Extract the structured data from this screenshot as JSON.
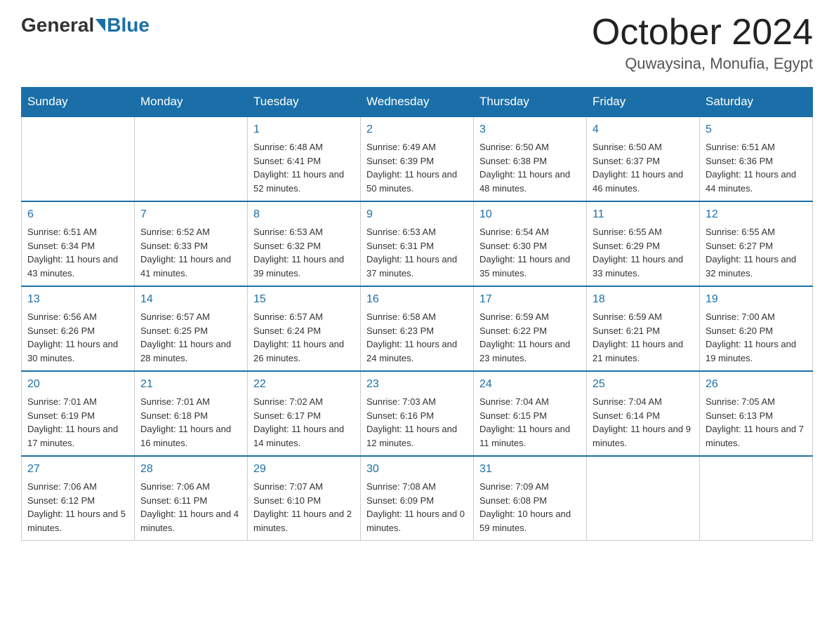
{
  "logo": {
    "general": "General",
    "blue": "Blue"
  },
  "title": "October 2024",
  "location": "Quwaysina, Monufia, Egypt",
  "days": [
    "Sunday",
    "Monday",
    "Tuesday",
    "Wednesday",
    "Thursday",
    "Friday",
    "Saturday"
  ],
  "weeks": [
    [
      {
        "num": "",
        "sunrise": "",
        "sunset": "",
        "daylight": ""
      },
      {
        "num": "",
        "sunrise": "",
        "sunset": "",
        "daylight": ""
      },
      {
        "num": "1",
        "sunrise": "Sunrise: 6:48 AM",
        "sunset": "Sunset: 6:41 PM",
        "daylight": "Daylight: 11 hours and 52 minutes."
      },
      {
        "num": "2",
        "sunrise": "Sunrise: 6:49 AM",
        "sunset": "Sunset: 6:39 PM",
        "daylight": "Daylight: 11 hours and 50 minutes."
      },
      {
        "num": "3",
        "sunrise": "Sunrise: 6:50 AM",
        "sunset": "Sunset: 6:38 PM",
        "daylight": "Daylight: 11 hours and 48 minutes."
      },
      {
        "num": "4",
        "sunrise": "Sunrise: 6:50 AM",
        "sunset": "Sunset: 6:37 PM",
        "daylight": "Daylight: 11 hours and 46 minutes."
      },
      {
        "num": "5",
        "sunrise": "Sunrise: 6:51 AM",
        "sunset": "Sunset: 6:36 PM",
        "daylight": "Daylight: 11 hours and 44 minutes."
      }
    ],
    [
      {
        "num": "6",
        "sunrise": "Sunrise: 6:51 AM",
        "sunset": "Sunset: 6:34 PM",
        "daylight": "Daylight: 11 hours and 43 minutes."
      },
      {
        "num": "7",
        "sunrise": "Sunrise: 6:52 AM",
        "sunset": "Sunset: 6:33 PM",
        "daylight": "Daylight: 11 hours and 41 minutes."
      },
      {
        "num": "8",
        "sunrise": "Sunrise: 6:53 AM",
        "sunset": "Sunset: 6:32 PM",
        "daylight": "Daylight: 11 hours and 39 minutes."
      },
      {
        "num": "9",
        "sunrise": "Sunrise: 6:53 AM",
        "sunset": "Sunset: 6:31 PM",
        "daylight": "Daylight: 11 hours and 37 minutes."
      },
      {
        "num": "10",
        "sunrise": "Sunrise: 6:54 AM",
        "sunset": "Sunset: 6:30 PM",
        "daylight": "Daylight: 11 hours and 35 minutes."
      },
      {
        "num": "11",
        "sunrise": "Sunrise: 6:55 AM",
        "sunset": "Sunset: 6:29 PM",
        "daylight": "Daylight: 11 hours and 33 minutes."
      },
      {
        "num": "12",
        "sunrise": "Sunrise: 6:55 AM",
        "sunset": "Sunset: 6:27 PM",
        "daylight": "Daylight: 11 hours and 32 minutes."
      }
    ],
    [
      {
        "num": "13",
        "sunrise": "Sunrise: 6:56 AM",
        "sunset": "Sunset: 6:26 PM",
        "daylight": "Daylight: 11 hours and 30 minutes."
      },
      {
        "num": "14",
        "sunrise": "Sunrise: 6:57 AM",
        "sunset": "Sunset: 6:25 PM",
        "daylight": "Daylight: 11 hours and 28 minutes."
      },
      {
        "num": "15",
        "sunrise": "Sunrise: 6:57 AM",
        "sunset": "Sunset: 6:24 PM",
        "daylight": "Daylight: 11 hours and 26 minutes."
      },
      {
        "num": "16",
        "sunrise": "Sunrise: 6:58 AM",
        "sunset": "Sunset: 6:23 PM",
        "daylight": "Daylight: 11 hours and 24 minutes."
      },
      {
        "num": "17",
        "sunrise": "Sunrise: 6:59 AM",
        "sunset": "Sunset: 6:22 PM",
        "daylight": "Daylight: 11 hours and 23 minutes."
      },
      {
        "num": "18",
        "sunrise": "Sunrise: 6:59 AM",
        "sunset": "Sunset: 6:21 PM",
        "daylight": "Daylight: 11 hours and 21 minutes."
      },
      {
        "num": "19",
        "sunrise": "Sunrise: 7:00 AM",
        "sunset": "Sunset: 6:20 PM",
        "daylight": "Daylight: 11 hours and 19 minutes."
      }
    ],
    [
      {
        "num": "20",
        "sunrise": "Sunrise: 7:01 AM",
        "sunset": "Sunset: 6:19 PM",
        "daylight": "Daylight: 11 hours and 17 minutes."
      },
      {
        "num": "21",
        "sunrise": "Sunrise: 7:01 AM",
        "sunset": "Sunset: 6:18 PM",
        "daylight": "Daylight: 11 hours and 16 minutes."
      },
      {
        "num": "22",
        "sunrise": "Sunrise: 7:02 AM",
        "sunset": "Sunset: 6:17 PM",
        "daylight": "Daylight: 11 hours and 14 minutes."
      },
      {
        "num": "23",
        "sunrise": "Sunrise: 7:03 AM",
        "sunset": "Sunset: 6:16 PM",
        "daylight": "Daylight: 11 hours and 12 minutes."
      },
      {
        "num": "24",
        "sunrise": "Sunrise: 7:04 AM",
        "sunset": "Sunset: 6:15 PM",
        "daylight": "Daylight: 11 hours and 11 minutes."
      },
      {
        "num": "25",
        "sunrise": "Sunrise: 7:04 AM",
        "sunset": "Sunset: 6:14 PM",
        "daylight": "Daylight: 11 hours and 9 minutes."
      },
      {
        "num": "26",
        "sunrise": "Sunrise: 7:05 AM",
        "sunset": "Sunset: 6:13 PM",
        "daylight": "Daylight: 11 hours and 7 minutes."
      }
    ],
    [
      {
        "num": "27",
        "sunrise": "Sunrise: 7:06 AM",
        "sunset": "Sunset: 6:12 PM",
        "daylight": "Daylight: 11 hours and 5 minutes."
      },
      {
        "num": "28",
        "sunrise": "Sunrise: 7:06 AM",
        "sunset": "Sunset: 6:11 PM",
        "daylight": "Daylight: 11 hours and 4 minutes."
      },
      {
        "num": "29",
        "sunrise": "Sunrise: 7:07 AM",
        "sunset": "Sunset: 6:10 PM",
        "daylight": "Daylight: 11 hours and 2 minutes."
      },
      {
        "num": "30",
        "sunrise": "Sunrise: 7:08 AM",
        "sunset": "Sunset: 6:09 PM",
        "daylight": "Daylight: 11 hours and 0 minutes."
      },
      {
        "num": "31",
        "sunrise": "Sunrise: 7:09 AM",
        "sunset": "Sunset: 6:08 PM",
        "daylight": "Daylight: 10 hours and 59 minutes."
      },
      {
        "num": "",
        "sunrise": "",
        "sunset": "",
        "daylight": ""
      },
      {
        "num": "",
        "sunrise": "",
        "sunset": "",
        "daylight": ""
      }
    ]
  ]
}
